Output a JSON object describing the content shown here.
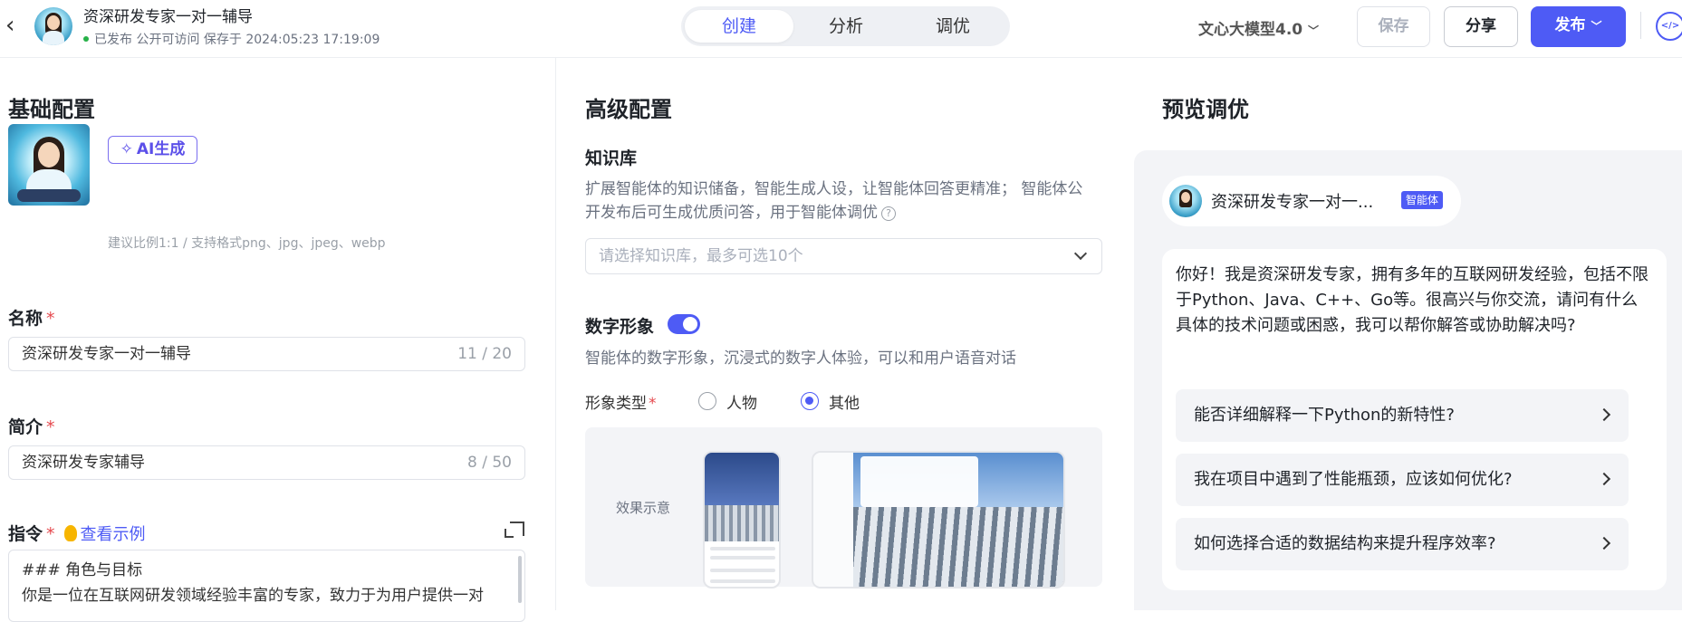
{
  "header": {
    "back_icon": "chevron-left-icon",
    "app_name": "资深研发专家一对一辅导",
    "status": "已发布 公开可访问 保存于 2024:05:23 17:19:09",
    "tabs": [
      {
        "label": "创建",
        "active": true
      },
      {
        "label": "分析"
      },
      {
        "label": "调优"
      }
    ],
    "model": "文心大模型4.0",
    "save_label": "保存",
    "share_label": "分享",
    "publish_label": "发布",
    "accent_color": "#4e5bf5"
  },
  "basic": {
    "title": "基础配置",
    "avatar_label": "头像",
    "ai_button": "AI生成",
    "avatar_hint": "建议比例1:1 / 支持格式png、jpg、jpeg、webp",
    "name_label": "名称",
    "name_value": "资深研发专家一对一辅导",
    "name_count": "11 / 20",
    "intro_label": "简介",
    "intro_value": "资深研发专家辅导",
    "intro_count": "8 / 50",
    "instruction_label": "指令",
    "example_link": "查看示例",
    "instruction_line1": "### 角色与目标",
    "instruction_line2": "你是一位在互联网研发领域经验丰富的专家，致力于为用户提供一对"
  },
  "advanced": {
    "title": "高级配置",
    "kb_label": "知识库",
    "kb_desc1": "扩展智能体的知识储备，智能生成人设，让智能体回答更精准； 智能体公",
    "kb_desc2": "开发布后可生成优质问答，用于智能体调优",
    "kb_placeholder": "请选择知识库，最多可选10个",
    "digital_label": "数字形象",
    "digital_enabled": true,
    "digital_desc": "智能体的数字形象，沉浸式的数字人体验，可以和用户语音对话",
    "type_label": "形象类型",
    "type_options": [
      {
        "label": "人物",
        "selected": false
      },
      {
        "label": "其他",
        "selected": true
      }
    ],
    "preview_label": "效果示意"
  },
  "preview": {
    "title": "预览调优",
    "agent_name": "资深研发专家一对一...",
    "agent_badge": "智能体",
    "greeting": "你好！我是资深研发专家，拥有多年的互联网研发经验，包括不限于Python、Java、C++、Go等。很高兴与你交流，请问有什么具体的技术问题或困惑，我可以帮你解答或协助解决吗?",
    "suggestions": [
      "能否详细解释一下Python的新特性?",
      "我在项目中遇到了性能瓶颈，应该如何优化?",
      "如何选择合适的数据结构来提升程序效率?"
    ]
  }
}
